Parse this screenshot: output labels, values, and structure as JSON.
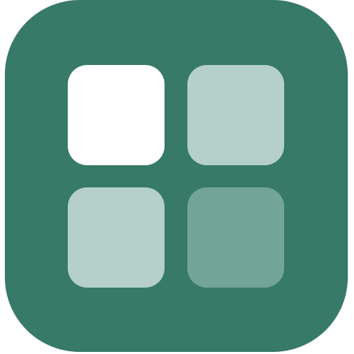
{
  "icon": {
    "name": "app-grid-icon",
    "background_color": "#367a67",
    "tiles": [
      {
        "name": "tile-top-left",
        "color": "#ffffff"
      },
      {
        "name": "tile-top-right",
        "color": "#b4d0c8"
      },
      {
        "name": "tile-bottom-left",
        "color": "#b4d0c8"
      },
      {
        "name": "tile-bottom-right",
        "color": "#72a596"
      }
    ]
  }
}
